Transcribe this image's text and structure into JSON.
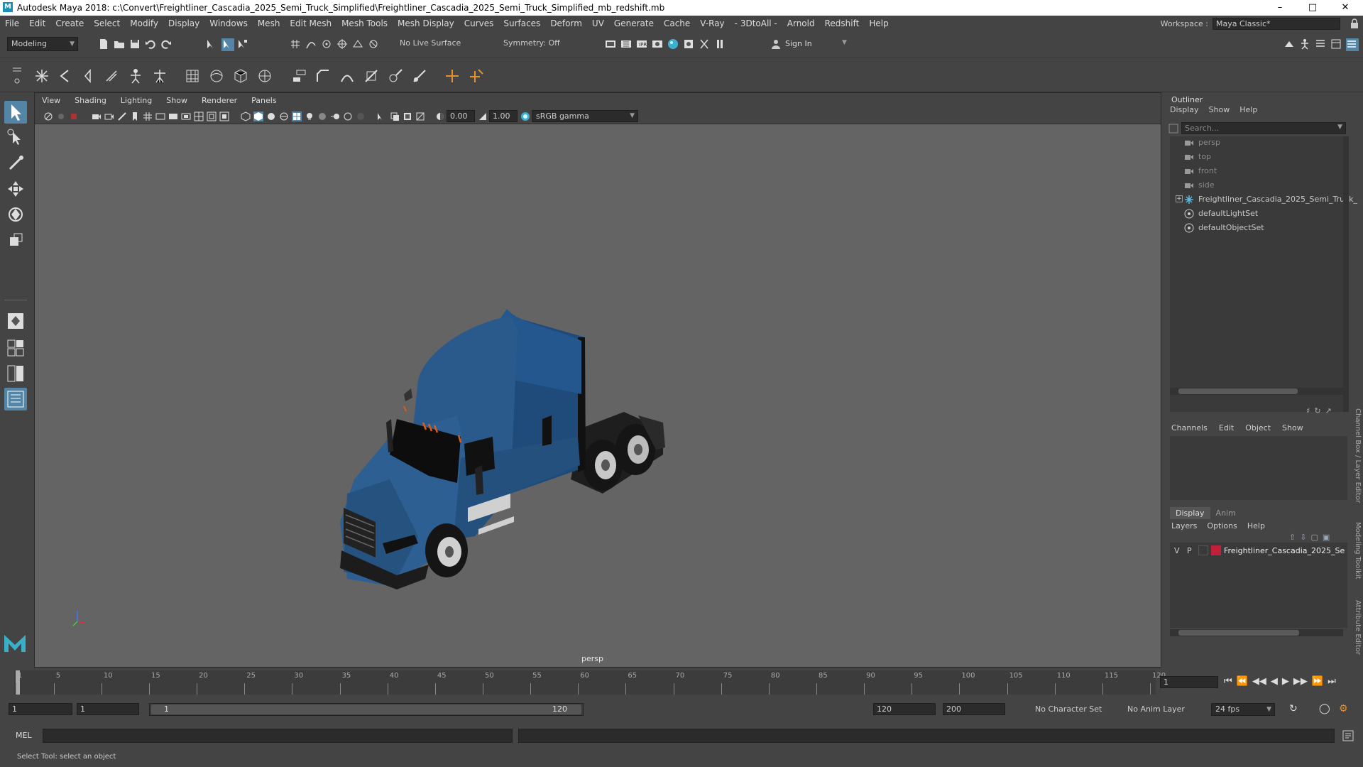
{
  "titlebar": {
    "title": "Autodesk Maya 2018: c:\\Convert\\Freightliner_Cascadia_2025_Semi_Truck_Simplified\\Freightliner_Cascadia_2025_Semi_Truck_Simplified_mb_redshift.mb",
    "logo": "M"
  },
  "menubar": {
    "items": [
      "File",
      "Edit",
      "Create",
      "Select",
      "Modify",
      "Display",
      "Windows",
      "Mesh",
      "Edit Mesh",
      "Mesh Tools",
      "Mesh Display",
      "Curves",
      "Surfaces",
      "Deform",
      "UV",
      "Generate",
      "Cache",
      "V-Ray",
      "- 3DtoAll -",
      "Arnold",
      "Redshift",
      "Help"
    ],
    "workspace_label": "Workspace :",
    "workspace_value": "Maya Classic*"
  },
  "statusline": {
    "mode": "Modeling",
    "live_surface": "No Live Surface",
    "symmetry": "Symmetry: Off",
    "sign_in": "Sign In"
  },
  "viewport": {
    "menu": [
      "View",
      "Shading",
      "Lighting",
      "Show",
      "Renderer",
      "Panels"
    ],
    "exposure": "0.00",
    "gamma": "1.00",
    "color_space": "sRGB gamma",
    "camera": "persp"
  },
  "outliner": {
    "title": "Outliner",
    "menu": [
      "Display",
      "Show",
      "Help"
    ],
    "search_placeholder": "Search...",
    "items": [
      {
        "label": "persp",
        "icon": "camera-icon",
        "dim": true
      },
      {
        "label": "top",
        "icon": "camera-icon",
        "dim": true
      },
      {
        "label": "front",
        "icon": "camera-icon",
        "dim": true
      },
      {
        "label": "side",
        "icon": "camera-icon",
        "dim": true
      },
      {
        "label": "Freightliner_Cascadia_2025_Semi_Truck_",
        "icon": "group-icon",
        "dim": false
      },
      {
        "label": "defaultLightSet",
        "icon": "set-icon",
        "dim": false
      },
      {
        "label": "defaultObjectSet",
        "icon": "set-icon",
        "dim": false
      }
    ]
  },
  "channelbox": {
    "menu": [
      "Channels",
      "Edit",
      "Object",
      "Show"
    ]
  },
  "layers": {
    "tabs": [
      "Display",
      "Anim"
    ],
    "menu": [
      "Layers",
      "Options",
      "Help"
    ],
    "row": {
      "v": "V",
      "p": "P",
      "name": "Freightliner_Cascadia_2025_Se",
      "color": "#c0203a"
    }
  },
  "sidetabs": [
    "Channel Box / Layer Editor",
    "Modeling Toolkit",
    "Attribute Editor"
  ],
  "timeslider": {
    "ticks": [
      "1",
      "5",
      "10",
      "15",
      "20",
      "25",
      "30",
      "35",
      "40",
      "45",
      "50",
      "55",
      "60",
      "65",
      "70",
      "75",
      "80",
      "85",
      "90",
      "95",
      "100",
      "105",
      "110",
      "115",
      "120"
    ],
    "current_frame": "1"
  },
  "range": {
    "start": "1",
    "playback_start": "1",
    "slider_start": "1",
    "slider_end": "120",
    "playback_end": "120",
    "end": "200",
    "character_set": "No Character Set",
    "anim_layer": "No Anim Layer",
    "fps": "24 fps"
  },
  "cmdline": {
    "label": "MEL"
  },
  "helpline": {
    "text": "Select Tool: select an object"
  },
  "colors": {
    "accent": "#5285a6",
    "truck_body": "#2a5a8c"
  }
}
